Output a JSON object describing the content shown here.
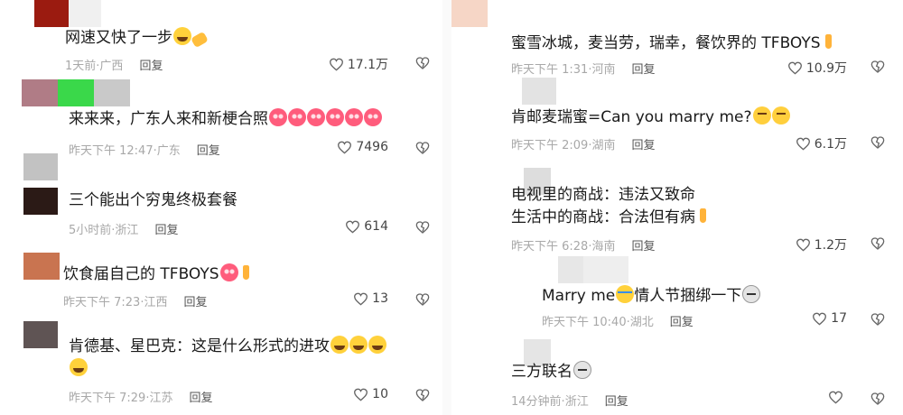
{
  "left_comments": [
    {
      "text": "网速又快了一步",
      "emojis": [
        "sweat-smile-emoji",
        "tape-emoji"
      ],
      "time": "1天前",
      "location": "广西",
      "reply": "回复",
      "likes": "17.1万"
    },
    {
      "text": "来来来，广东人来和新梗合照",
      "emojis": [
        "love-face-emoji",
        "love-face-emoji",
        "love-face-emoji",
        "love-face-emoji",
        "love-face-emoji",
        "love-face-emoji"
      ],
      "time": "昨天下午 12:47",
      "location": "广东",
      "reply": "回复",
      "likes": "7496"
    },
    {
      "text": "三个能出个穷鬼终极套餐",
      "emojis": [],
      "time": "5小时前",
      "location": "浙江",
      "reply": "回复",
      "likes": "614"
    },
    {
      "text": "饮食届自己的 TFBOYS",
      "emojis": [
        "love-face-emoji",
        "peace-hand-emoji"
      ],
      "time": "昨天下午 7:23",
      "location": "江西",
      "reply": "回复",
      "likes": "13"
    },
    {
      "text": "肯德基、星巴克：这是什么形式的进攻",
      "emojis": [
        "sweat-smile-emoji",
        "sweat-smile-emoji",
        "sweat-smile-emoji"
      ],
      "line2_emojis": [
        "sweat-smile-emoji"
      ],
      "time": "昨天下午 7:29",
      "location": "江苏",
      "reply": "回复",
      "likes": "10"
    }
  ],
  "right_comments": [
    {
      "text": "蜜雪冰城，麦当劳，瑞幸，餐饮界的 TFBOYS",
      "emojis": [
        "peace-hand-emoji"
      ],
      "time": "昨天下午 1:31",
      "location": "河南",
      "reply": "回复",
      "likes": "10.9万"
    },
    {
      "text": "肯邮麦瑞蜜=Can you marry me?",
      "emojis": [
        "flushed-emoji",
        "flushed-emoji"
      ],
      "time": "昨天下午 2:09",
      "location": "湖南",
      "reply": "回复",
      "likes": "6.1万"
    },
    {
      "text": "电视里的商战：违法又致命",
      "line2": "生活中的商战：合法但有病",
      "emojis": [],
      "line2_emojis": [
        "peace-hand-emoji"
      ],
      "time": "昨天下午 6:28",
      "location": "海南",
      "reply": "回复",
      "likes": "1.2万"
    },
    {
      "text": "Marry me",
      "emojis": [
        "crying-laugh-emoji"
      ],
      "text_after": "情人节捆绑一下",
      "emojis_after": [
        "cat-emoji"
      ],
      "time": "昨天下午 10:40",
      "location": "湖北",
      "reply": "回复",
      "likes": "17"
    },
    {
      "text": "三方联名",
      "emojis": [
        "cat-emoji"
      ],
      "time": "14分钟前",
      "location": "浙江",
      "reply": "回复",
      "likes": ""
    }
  ],
  "colors": {
    "text": "#1a1a1a",
    "meta": "#a8a8a8",
    "reply": "#555555",
    "icon": "#666666"
  }
}
